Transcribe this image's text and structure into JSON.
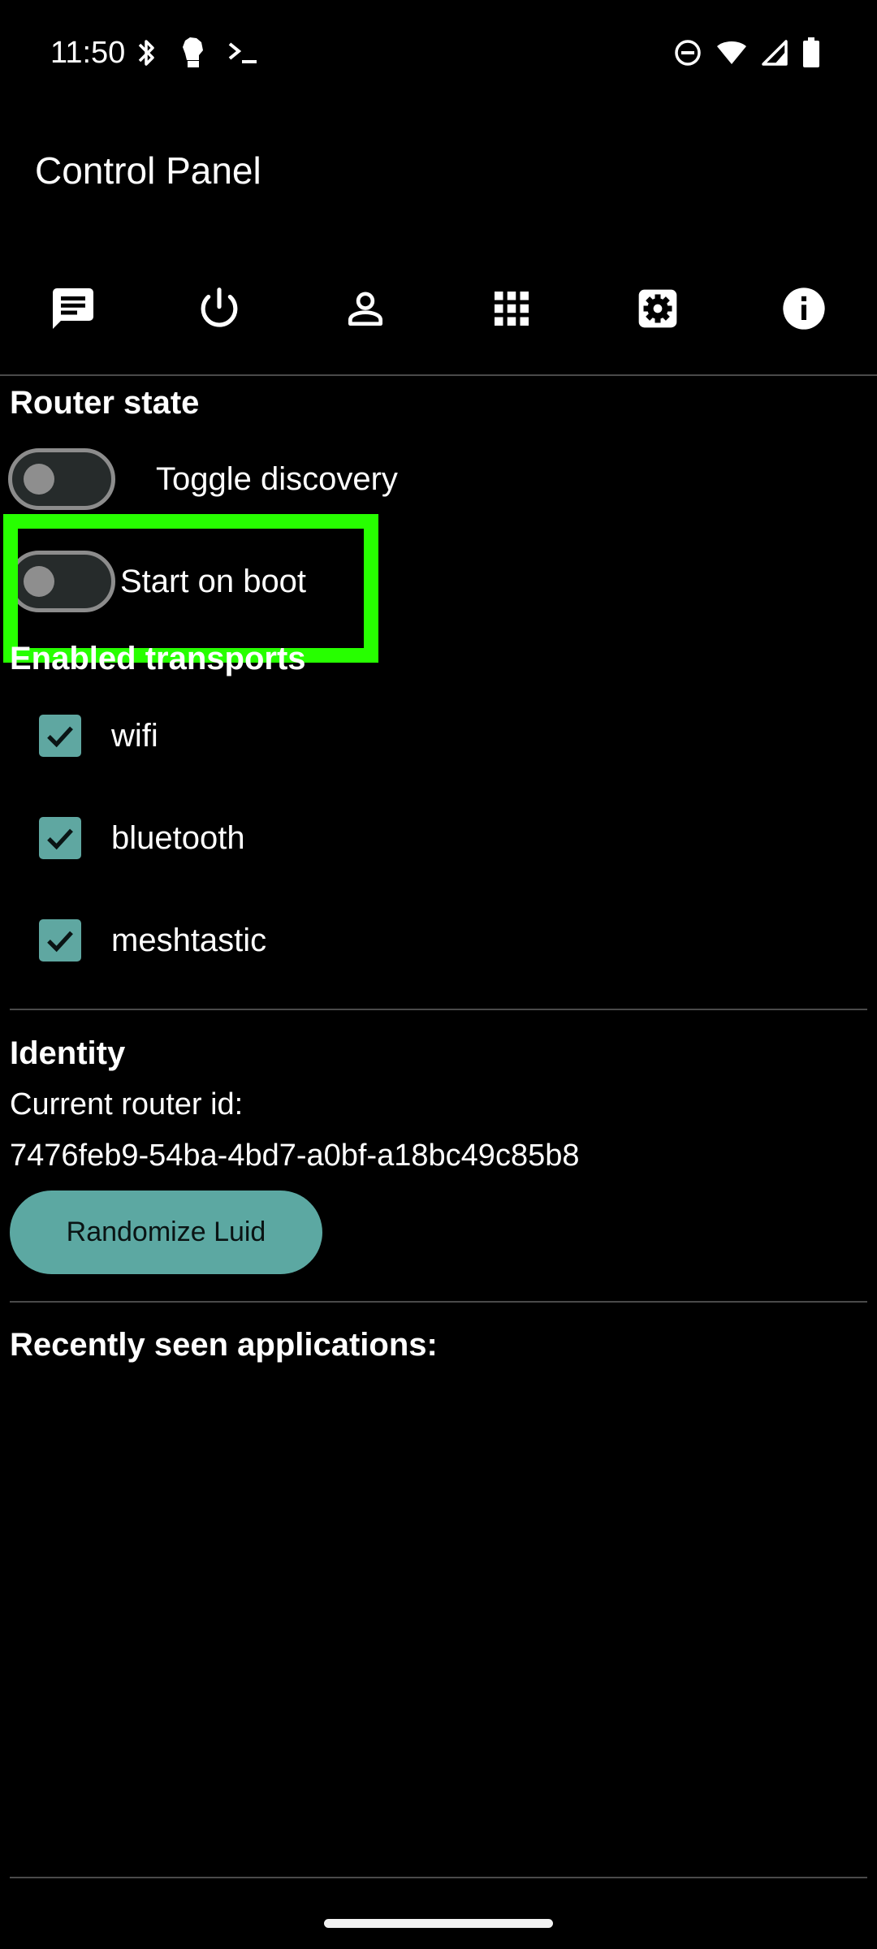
{
  "status_bar": {
    "time": "11:50",
    "left_icons": [
      "bluetooth-icon",
      "hand-icon",
      "terminal-icon"
    ],
    "right_icons": [
      "do-not-disturb-icon",
      "wifi-icon",
      "cell-signal-icon",
      "battery-icon"
    ]
  },
  "app_bar": {
    "title": "Control Panel"
  },
  "tabs": [
    {
      "icon": "message-icon",
      "selected": true
    },
    {
      "icon": "power-icon"
    },
    {
      "icon": "person-icon"
    },
    {
      "icon": "apps-grid-icon"
    },
    {
      "icon": "settings-icon"
    },
    {
      "icon": "info-icon"
    }
  ],
  "router_state": {
    "title": "Router state",
    "toggle_discovery": {
      "label": "Toggle discovery",
      "on": false
    },
    "start_on_boot": {
      "label": "Start on boot",
      "on": false
    }
  },
  "transports": {
    "title": "Enabled transports",
    "items": [
      {
        "label": "wifi",
        "checked": true
      },
      {
        "label": "bluetooth",
        "checked": true
      },
      {
        "label": "meshtastic",
        "checked": true
      }
    ]
  },
  "identity": {
    "title": "Identity",
    "router_id_label": "Current router id:",
    "router_id": "7476feb9-54ba-4bd7-a0bf-a18bc49c85b8",
    "randomize_button": "Randomize Luid"
  },
  "recent_apps": {
    "title": "Recently seen applications:"
  },
  "colors": {
    "accent": "#5ca8a2",
    "highlight": "#27ff00",
    "background": "#000000"
  }
}
